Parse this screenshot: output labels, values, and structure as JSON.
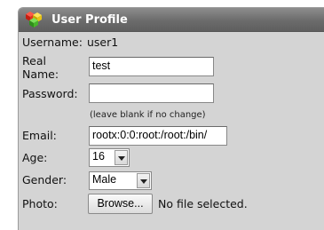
{
  "header": {
    "title": "User Profile",
    "icon": "cubes-icon"
  },
  "form": {
    "username_label": "Username:",
    "username_value": "user1",
    "realname_label_line1": "Real",
    "realname_label_line2": "Name:",
    "realname_value": "test",
    "password_label": "Password:",
    "password_value": "",
    "password_hint": "(leave blank if no change)",
    "email_label": "Email:",
    "email_value": "rootx:0:0:root:/root:/bin/",
    "age_label": "Age:",
    "age_value": "16",
    "gender_label": "Gender:",
    "gender_value": "Male",
    "photo_label": "Photo:",
    "browse_label": "Browse...",
    "file_status": "No file selected."
  }
}
